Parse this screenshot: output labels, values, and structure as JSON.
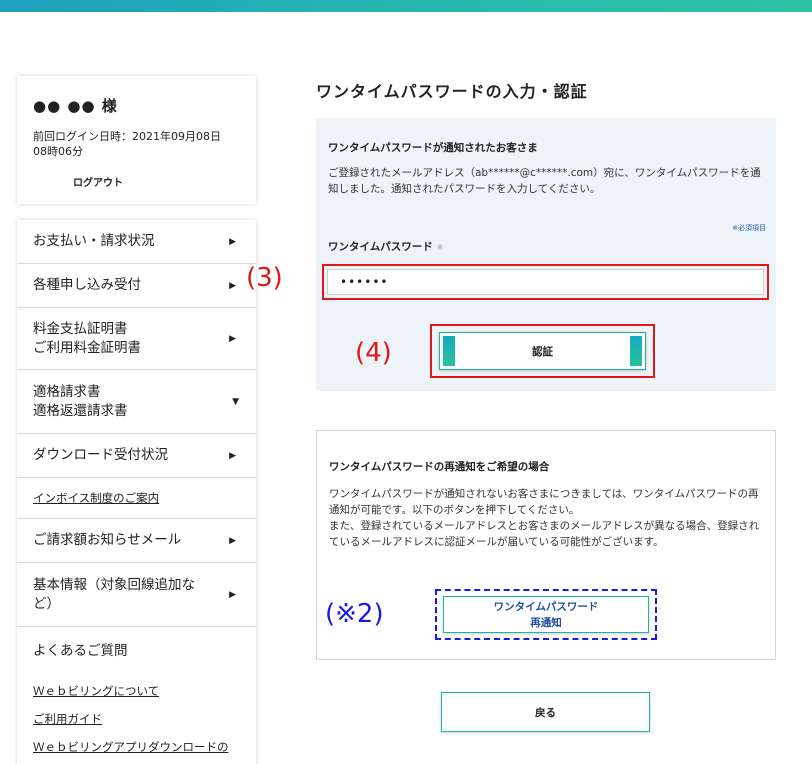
{
  "user": {
    "name": "●● ●● 様",
    "last_login": "前回ログイン日時：2021年09月08日 08時06分",
    "logout_label": "ログアウト"
  },
  "sidebar": {
    "items": [
      {
        "label": "お支払い・請求状況"
      },
      {
        "label": "各種申し込み受付"
      },
      {
        "label": "料金支払証明書\nご利用料金証明書"
      },
      {
        "label": "適格請求書\n適格返還請求書"
      },
      {
        "label": "ダウンロード受付状況"
      },
      {
        "label": "インボイス制度のご案内"
      },
      {
        "label": "ご請求額お知らせメール"
      },
      {
        "label": "基本情報（対象回線追加など）"
      },
      {
        "label": "よくあるご質問"
      }
    ],
    "links": [
      {
        "label": "Ｗｅｂビリングについて"
      },
      {
        "label": "ご利用ガイド"
      },
      {
        "label": "Ｗｅｂビリングアプリダウンロードの"
      }
    ]
  },
  "main": {
    "title": "ワンタイムパスワードの入力・認証",
    "otp_panel": {
      "heading": "ワンタイムパスワードが通知されたお客さま",
      "description": "ご登録されたメールアドレス（ab******@c******.com）宛に、ワンタイムパスワードを通知しました。通知されたパスワードを入力してください。",
      "required_note": "※必須項目",
      "field_label": "ワンタイムパスワード",
      "required_mark": "※",
      "input_value": "••••••",
      "submit_label": "認証"
    },
    "renotify_panel": {
      "heading": "ワンタイムパスワードの再通知をご希望の場合",
      "description": "ワンタイムパスワードが通知されないお客さまにつきましては、ワンタイムパスワードの再通知が可能です。以下のボタンを押下してください。\nまた、登録されているメールアドレスとお客さまのメールアドレスが異なる場合、登録されているメールアドレスに認証メールが届いている可能性がございます。",
      "button_label_line1": "ワンタイムパスワード",
      "button_label_line2": "再通知"
    },
    "back_label": "戻る"
  },
  "annotations": {
    "step3": "(3)",
    "step4": "(4)",
    "note2": "(※2)"
  },
  "colors": {
    "accent": "#20b3a5",
    "highlight_red": "#e0171b",
    "highlight_blue": "#1a1ae6",
    "panel_bg": "#eef3f7"
  }
}
